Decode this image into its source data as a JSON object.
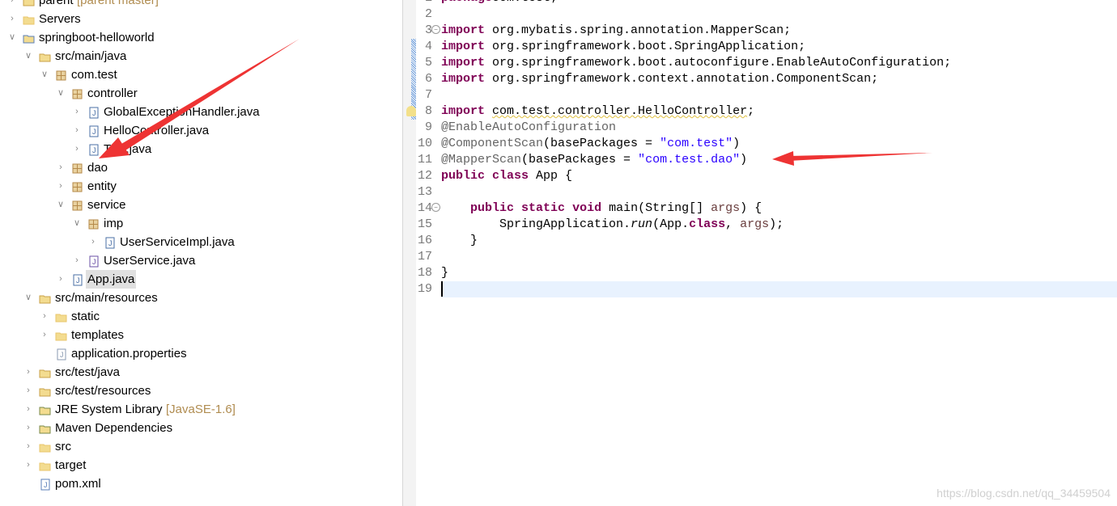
{
  "explorer": {
    "items": [
      {
        "label": "parent",
        "decoration": "[parent master]",
        "level": 0,
        "expanded": false,
        "icon": "project-icon"
      },
      {
        "label": "Servers",
        "level": 0,
        "expanded": false,
        "icon": "folder-icon"
      },
      {
        "label": "springboot-helloworld",
        "level": 0,
        "expanded": true,
        "icon": "maven-project-icon"
      },
      {
        "label": "src/main/java",
        "level": 1,
        "expanded": true,
        "icon": "source-folder-icon"
      },
      {
        "label": "com.test",
        "level": 2,
        "expanded": true,
        "icon": "package-icon"
      },
      {
        "label": "controller",
        "level": 3,
        "expanded": true,
        "icon": "package-icon"
      },
      {
        "label": "GlobalExceptionHandler.java",
        "level": 4,
        "expanded": false,
        "icon": "java-file-icon"
      },
      {
        "label": "HelloController.java",
        "level": 4,
        "expanded": false,
        "icon": "java-file-icon"
      },
      {
        "label": "Test.java",
        "level": 4,
        "expanded": false,
        "icon": "java-file-icon"
      },
      {
        "label": "dao",
        "level": 3,
        "expanded": false,
        "icon": "package-icon"
      },
      {
        "label": "entity",
        "level": 3,
        "expanded": false,
        "icon": "package-icon"
      },
      {
        "label": "service",
        "level": 3,
        "expanded": true,
        "icon": "package-icon"
      },
      {
        "label": "imp",
        "level": 4,
        "expanded": true,
        "icon": "package-icon"
      },
      {
        "label": "UserServiceImpl.java",
        "level": 5,
        "expanded": false,
        "icon": "java-file-icon"
      },
      {
        "label": "UserService.java",
        "level": 4,
        "expanded": false,
        "icon": "java-interface-icon"
      },
      {
        "label": "App.java",
        "level": 3,
        "expanded": false,
        "icon": "java-file-icon",
        "selected": true
      },
      {
        "label": "src/main/resources",
        "level": 1,
        "expanded": true,
        "icon": "source-folder-icon"
      },
      {
        "label": "static",
        "level": 2,
        "expanded": false,
        "icon": "folder-icon"
      },
      {
        "label": "templates",
        "level": 2,
        "expanded": false,
        "icon": "folder-icon"
      },
      {
        "label": "application.properties",
        "level": 2,
        "leaf": true,
        "icon": "properties-file-icon"
      },
      {
        "label": "src/test/java",
        "level": 1,
        "expanded": false,
        "icon": "source-folder-icon"
      },
      {
        "label": "src/test/resources",
        "level": 1,
        "expanded": false,
        "icon": "source-folder-icon"
      },
      {
        "label": "JRE System Library",
        "decoration": "[JavaSE-1.6]",
        "level": 1,
        "expanded": false,
        "icon": "library-icon"
      },
      {
        "label": "Maven Dependencies",
        "level": 1,
        "expanded": false,
        "icon": "library-icon"
      },
      {
        "label": "src",
        "level": 1,
        "expanded": false,
        "icon": "folder-icon"
      },
      {
        "label": "target",
        "level": 1,
        "expanded": false,
        "icon": "folder-icon"
      },
      {
        "label": "pom.xml",
        "level": 1,
        "leaf": true,
        "icon": "xml-file-icon"
      }
    ]
  },
  "editor": {
    "current_line": 19,
    "lines": [
      [
        [
          "kw",
          "package"
        ],
        [
          "",
          "com.test;"
        ]
      ],
      [],
      [
        [
          "kw",
          "import"
        ],
        [
          "",
          " org.mybatis.spring.annotation.MapperScan;"
        ]
      ],
      [
        [
          "kw",
          "import"
        ],
        [
          "",
          " org.springframework.boot.SpringApplication;"
        ]
      ],
      [
        [
          "kw",
          "import"
        ],
        [
          "",
          " org.springframework.boot.autoconfigure.EnableAutoConfiguration;"
        ]
      ],
      [
        [
          "kw",
          "import"
        ],
        [
          "",
          " org.springframework.context.annotation.ComponentScan;"
        ]
      ],
      [],
      [
        [
          "kw",
          "import"
        ],
        [
          "",
          " "
        ],
        [
          "warn",
          "com.test.controller.HelloController"
        ],
        [
          "",
          ";"
        ]
      ],
      [
        [
          "an",
          "@EnableAutoConfiguration"
        ]
      ],
      [
        [
          "an",
          "@ComponentScan"
        ],
        [
          "",
          "(basePackages = "
        ],
        [
          "st",
          "\"com.test\""
        ],
        [
          "",
          ")"
        ]
      ],
      [
        [
          "an",
          "@MapperScan"
        ],
        [
          "",
          "(basePackages = "
        ],
        [
          "st",
          "\"com.test.dao\""
        ],
        [
          "",
          ")"
        ]
      ],
      [
        [
          "kw",
          "public"
        ],
        [
          "",
          " "
        ],
        [
          "kw",
          "class"
        ],
        [
          "",
          " App {"
        ]
      ],
      [],
      [
        [
          "",
          "    "
        ],
        [
          "kw",
          "public"
        ],
        [
          "",
          " "
        ],
        [
          "kw",
          "static"
        ],
        [
          "",
          " "
        ],
        [
          "kw",
          "void"
        ],
        [
          "",
          " main(String[] "
        ],
        [
          "pm",
          "args"
        ],
        [
          "",
          ") {"
        ]
      ],
      [
        [
          "",
          "        SpringApplication."
        ],
        [
          "it",
          "run"
        ],
        [
          "",
          "(App."
        ],
        [
          "kw",
          "class"
        ],
        [
          "",
          ", "
        ],
        [
          "pm",
          "args"
        ],
        [
          "",
          ");"
        ]
      ],
      [
        [
          "",
          "    }"
        ]
      ],
      [],
      [
        [
          "",
          "}"
        ]
      ],
      []
    ],
    "fold_lines": [
      3,
      14
    ],
    "warning_line": 8
  },
  "watermark": "https://blog.csdn.net/qq_34459504",
  "colors": {
    "annotation_arrow": "#ee3333",
    "keyword": "#7f0055",
    "string": "#2a00ff",
    "current_line": "#e8f2fe"
  }
}
